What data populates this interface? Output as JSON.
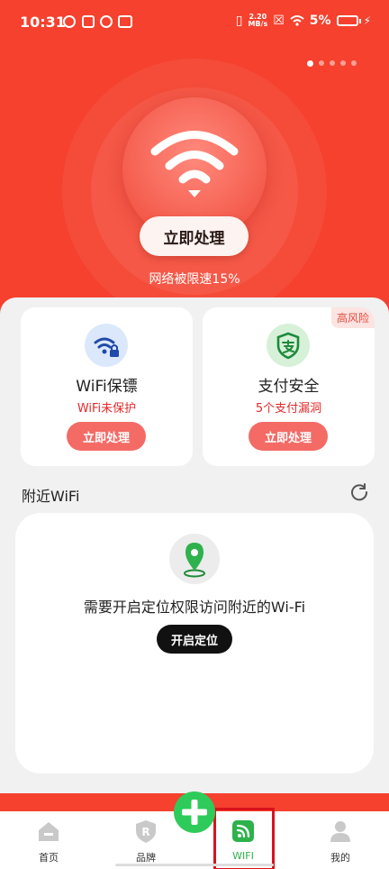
{
  "status_bar": {
    "time": "10:31",
    "net_speed_value": "2.20",
    "net_speed_unit": "MB/s",
    "battery": "5%"
  },
  "hero": {
    "action_label": "立即处理",
    "subtitle": "网络被限速15%",
    "page_count": 5,
    "active_page": 1
  },
  "cards": [
    {
      "title": "WiFi保镖",
      "warning": "WiFi未保护",
      "button": "立即处理",
      "icon": "wifi-lock-icon"
    },
    {
      "title": "支付安全",
      "warning": "5个支付漏洞",
      "button": "立即处理",
      "tag": "高风险",
      "icon": "payment-shield-icon"
    }
  ],
  "nearby": {
    "title": "附近WiFi",
    "message": "需要开启定位权限访问附近的Wi-Fi",
    "button": "开启定位"
  },
  "tabs": [
    {
      "label": "首页",
      "icon": "home-icon"
    },
    {
      "label": "品牌",
      "icon": "brand-shield-icon"
    },
    {
      "label": "WIFI",
      "icon": "wifi-tab-icon",
      "active": true
    },
    {
      "label": "我的",
      "icon": "user-icon"
    }
  ],
  "colors": {
    "primary_red": "#f5412e",
    "button_red": "#f46b66",
    "warning_red": "#e02a2a",
    "active_green": "#2eb24b"
  }
}
